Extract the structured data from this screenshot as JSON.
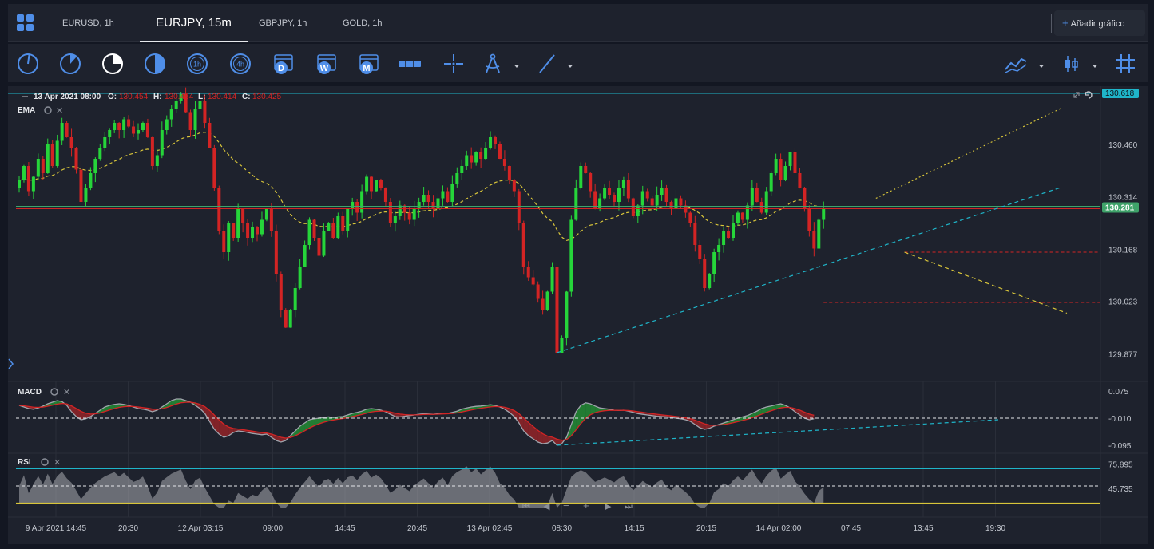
{
  "tabs": [
    {
      "label": "EURUSD, 1h"
    },
    {
      "label": "EURJPY, 15m"
    },
    {
      "label": "GBPJPY, 1h"
    },
    {
      "label": "GOLD, 1h"
    }
  ],
  "add_chart": {
    "label": "Añadir gráfico"
  },
  "toolbar": {
    "timeframes": [
      "1m",
      "5m",
      "15m",
      "30m",
      "1h",
      "4h",
      "D",
      "W",
      "M"
    ],
    "icons": [
      "clock-1m-icon",
      "clock-5m-icon",
      "clock-15m-icon",
      "clock-30m-icon",
      "clock-1h-icon",
      "clock-4h-icon",
      "calendar-day-icon",
      "calendar-week-icon",
      "calendar-month-icon",
      "bar-spacing-icon",
      "crosshair-icon",
      "drawing-compass-icon",
      "trend-line-icon",
      "indicators-icon",
      "candle-type-icon",
      "grid-icon"
    ]
  },
  "colors": {
    "bg": "#131722",
    "panel": "#1e222d",
    "up": "#26d53a",
    "down": "#d32424",
    "accent": "#4f8ee8",
    "cyan": "#1fb5c9",
    "yellow": "#d8c53a"
  },
  "chart_data": {
    "type": "candlestick",
    "symbol": "EURJPY, 15m",
    "ohlc_legend": {
      "date": "13 Apr 2021 08:00",
      "o_label": "O:",
      "o": "130.454",
      "h_label": "H:",
      "h": "130.454",
      "l_label": "L:",
      "l": "130.414",
      "c_label": "C:",
      "c": "130.425"
    },
    "price_axis": {
      "ticks": [
        "130.460",
        "130.314",
        "130.168",
        "130.023",
        "129.877"
      ],
      "tick_values": [
        130.46,
        130.314,
        130.168,
        130.023,
        129.877
      ],
      "ylim": [
        129.8,
        130.6
      ],
      "top_label": "130.618",
      "current_price_label": "130.281",
      "current_price": 130.281
    },
    "time_axis": [
      "9 Apr 2021 14:45",
      "20:30",
      "12 Apr 03:15",
      "09:00",
      "14:45",
      "20:45",
      "13 Apr 02:45",
      "08:30",
      "14:15",
      "20:15",
      "14 Apr 02:00",
      "07:45",
      "13:45",
      "19:30"
    ],
    "closes": [
      130.36,
      130.4,
      130.33,
      130.37,
      130.42,
      130.38,
      130.46,
      130.4,
      130.47,
      130.52,
      130.48,
      130.45,
      130.39,
      130.3,
      130.34,
      130.38,
      130.42,
      130.45,
      130.48,
      130.5,
      130.52,
      130.5,
      130.53,
      130.51,
      130.49,
      130.5,
      130.52,
      130.48,
      130.4,
      130.43,
      130.5,
      130.53,
      130.56,
      130.58,
      130.6,
      130.55,
      130.5,
      130.56,
      130.58,
      130.52,
      130.45,
      130.34,
      130.22,
      130.16,
      130.24,
      130.2,
      130.28,
      130.24,
      130.2,
      130.23,
      130.21,
      130.25,
      130.28,
      130.22,
      130.1,
      130.0,
      129.95,
      130.0,
      130.06,
      130.12,
      130.18,
      130.25,
      130.2,
      130.15,
      130.22,
      130.24,
      130.2,
      130.26,
      130.22,
      130.28,
      130.3,
      130.27,
      130.33,
      130.37,
      130.33,
      130.36,
      130.34,
      130.3,
      130.24,
      130.26,
      130.29,
      130.27,
      130.25,
      130.28,
      130.3,
      130.32,
      130.3,
      130.28,
      130.31,
      130.33,
      130.3,
      130.35,
      130.38,
      130.4,
      130.43,
      130.41,
      130.44,
      130.42,
      130.45,
      130.48,
      130.46,
      130.42,
      130.4,
      130.36,
      130.33,
      130.24,
      130.12,
      130.09,
      130.07,
      130.03,
      130.0,
      130.05,
      130.12,
      129.88,
      129.92,
      130.05,
      130.25,
      130.34,
      130.4,
      130.38,
      130.33,
      130.28,
      130.31,
      130.34,
      130.32,
      130.3,
      130.34,
      130.36,
      130.31,
      130.26,
      130.29,
      130.33,
      130.31,
      130.29,
      130.32,
      130.34,
      130.3,
      130.28,
      130.31,
      130.29,
      130.27,
      130.24,
      130.18,
      130.14,
      130.06,
      130.1,
      130.16,
      130.18,
      130.22,
      130.2,
      130.24,
      130.27,
      130.25,
      130.29,
      130.34,
      130.3,
      130.27,
      130.33,
      130.38,
      130.42,
      130.36,
      130.4,
      130.44,
      130.38,
      130.34,
      130.28,
      130.22,
      130.17,
      130.25,
      130.28
    ],
    "ema": {
      "label": "EMA"
    },
    "annotations": {
      "horizontal_line": 130.281,
      "support_levels": [
        130.16,
        130.02
      ],
      "cyan_trendline": [
        [
          113,
          129.88
        ],
        [
          188,
          130.27
        ]
      ],
      "yellow_projection_up": [
        [
          180,
          130.31
        ],
        [
          200,
          130.56
        ]
      ],
      "yellow_projection_down": [
        [
          186,
          130.16
        ],
        [
          200,
          129.99
        ]
      ]
    },
    "macd": {
      "label": "MACD",
      "ticks": [
        "0.075",
        "-0.010",
        "-0.095"
      ],
      "tick_values": [
        0.075,
        -0.01,
        -0.095
      ],
      "ylim": [
        -0.12,
        0.1
      ],
      "macd_values": [
        0.03,
        0.025,
        0.02,
        0.018,
        0.022,
        0.028,
        0.035,
        0.04,
        0.045,
        0.042,
        0.03,
        0.01,
        -0.005,
        -0.015,
        -0.012,
        -0.005,
        0.005,
        0.015,
        0.025,
        0.03,
        0.033,
        0.035,
        0.033,
        0.03,
        0.025,
        0.02,
        0.018,
        0.015,
        0.01,
        0.015,
        0.025,
        0.035,
        0.045,
        0.05,
        0.05,
        0.045,
        0.04,
        0.03,
        0.02,
        0.005,
        -0.02,
        -0.045,
        -0.06,
        -0.07,
        -0.065,
        -0.055,
        -0.05,
        -0.052,
        -0.055,
        -0.058,
        -0.06,
        -0.062,
        -0.06,
        -0.07,
        -0.08,
        -0.085,
        -0.08,
        -0.065,
        -0.05,
        -0.035,
        -0.025,
        -0.015,
        -0.012,
        -0.01,
        -0.008,
        -0.006,
        -0.008,
        -0.006,
        -0.005,
        0.0,
        0.005,
        0.008,
        0.012,
        0.018,
        0.02,
        0.018,
        0.015,
        0.01,
        0.002,
        -0.005,
        -0.006,
        -0.004,
        -0.002,
        0.0,
        0.002,
        0.004,
        0.003,
        0.002,
        0.004,
        0.006,
        0.005,
        0.008,
        0.012,
        0.018,
        0.022,
        0.025,
        0.027,
        0.028,
        0.03,
        0.032,
        0.03,
        0.025,
        0.018,
        0.008,
        -0.005,
        -0.025,
        -0.05,
        -0.065,
        -0.075,
        -0.085,
        -0.09,
        -0.088,
        -0.08,
        -0.095,
        -0.09,
        -0.07,
        -0.03,
        0.01,
        0.03,
        0.038,
        0.035,
        0.028,
        0.022,
        0.02,
        0.018,
        0.015,
        0.014,
        0.015,
        0.012,
        0.008,
        0.004,
        0.002,
        0.0,
        -0.002,
        -0.004,
        -0.005,
        -0.006,
        -0.008,
        -0.01,
        -0.012,
        -0.015,
        -0.02,
        -0.03,
        -0.04,
        -0.045,
        -0.042,
        -0.035,
        -0.03,
        -0.025,
        -0.02,
        -0.015,
        -0.01,
        -0.006,
        -0.002,
        0.005,
        0.012,
        0.02,
        0.025,
        0.028,
        0.032,
        0.035,
        0.03,
        0.022,
        0.01,
        0.0,
        -0.01,
        -0.015,
        -0.012
      ]
    },
    "rsi": {
      "label": "RSI",
      "ticks": [
        "75.895",
        "45.735"
      ],
      "tick_values": [
        75.895,
        45.735
      ],
      "upper_band": 72,
      "lower_band": 28,
      "ylim": [
        10,
        90
      ]
    }
  }
}
